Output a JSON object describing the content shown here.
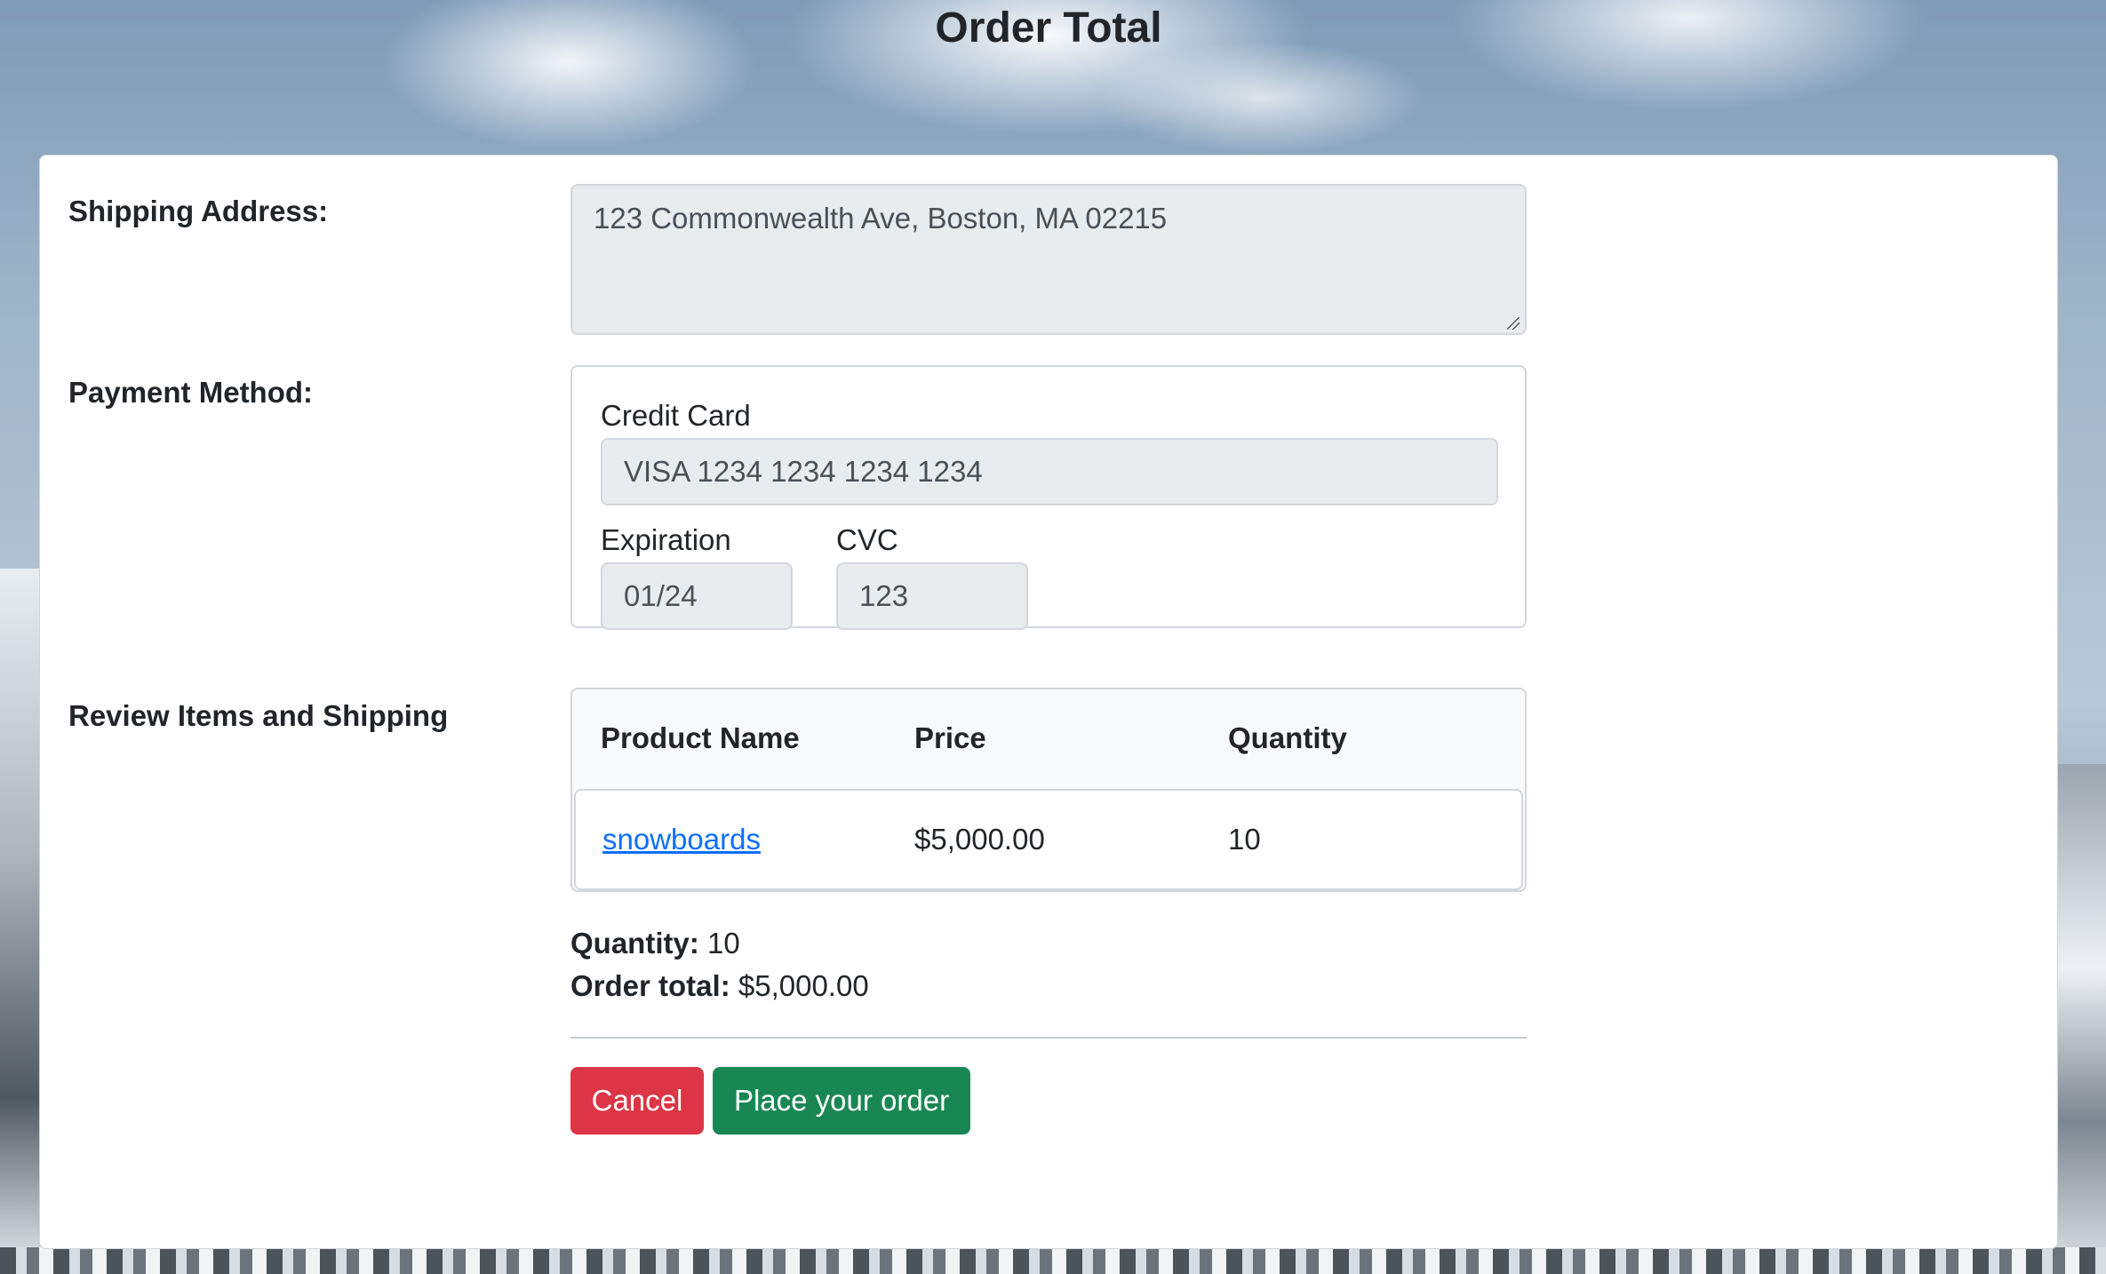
{
  "page": {
    "title": "Order Total"
  },
  "shipping": {
    "label": "Shipping Address:",
    "address": "123 Commonwealth Ave, Boston, MA 02215"
  },
  "payment": {
    "label": "Payment Method:",
    "card_label": "Credit Card",
    "card_value": "VISA 1234 1234 1234 1234",
    "expiration_label": "Expiration",
    "expiration_value": "01/24",
    "cvc_label": "CVC",
    "cvc_value": "123"
  },
  "review": {
    "label": "Review Items and Shipping",
    "columns": [
      "Product Name",
      "Price",
      "Quantity"
    ],
    "rows": [
      {
        "product": "snowboards",
        "price": "$5,000.00",
        "quantity": "10"
      }
    ]
  },
  "summary": {
    "quantity_label": "Quantity:",
    "quantity_value": "10",
    "total_label": "Order total:",
    "total_value": "$5,000.00"
  },
  "actions": {
    "cancel_label": "Cancel",
    "place_order_label": "Place your order",
    "cancel_color": "#dc3545",
    "place_order_color": "#198754"
  }
}
